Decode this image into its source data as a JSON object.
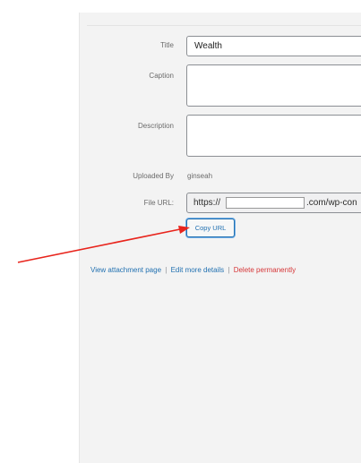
{
  "form": {
    "title_label": "Title",
    "title_value": "Wealth",
    "caption_label": "Caption",
    "description_label": "Description",
    "uploaded_by_label": "Uploaded By",
    "uploaded_by_value": "ginseah",
    "file_url_label": "File URL:",
    "file_url_prefix": "https://",
    "file_url_suffix": ".com/wp-con",
    "copy_url_label": "Copy URL"
  },
  "links": {
    "view": "View attachment page",
    "separator": "|",
    "edit": "Edit more details",
    "delete": "Delete permanently"
  },
  "annotation": {
    "arrow_color": "#e8241c"
  }
}
